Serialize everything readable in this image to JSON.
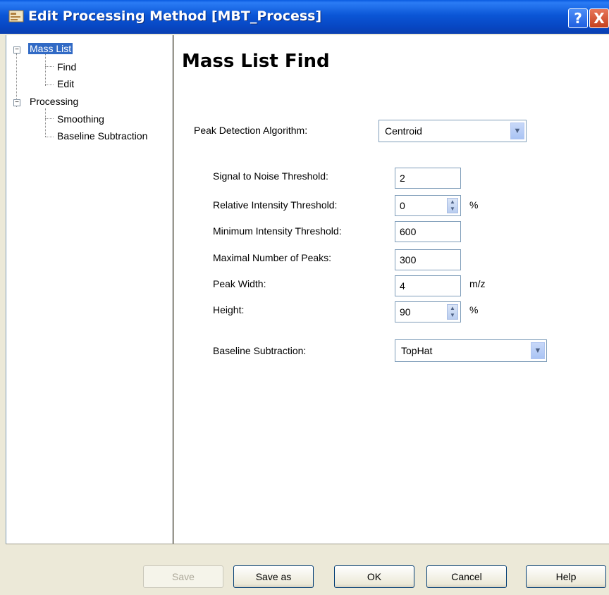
{
  "window": {
    "title": "Edit Processing Method [MBT_Process]",
    "help_glyph": "?",
    "close_glyph": "X"
  },
  "tree": {
    "expander_glyph": "−",
    "nodes": [
      {
        "label": "Mass List",
        "selected": true,
        "children": [
          "Find",
          "Edit"
        ]
      },
      {
        "label": "Processing",
        "selected": false,
        "children": [
          "Smoothing",
          "Baseline Subtraction"
        ]
      }
    ]
  },
  "content": {
    "heading": "Mass List Find",
    "peak_detection": {
      "label": "Peak Detection Algorithm:",
      "value": "Centroid"
    },
    "fields": [
      {
        "label": "Signal to Noise Threshold:",
        "value": "2",
        "unit": "",
        "spinner": false
      },
      {
        "label": "Relative Intensity Threshold:",
        "value": "0",
        "unit": "%",
        "spinner": true
      },
      {
        "label": "Minimum Intensity Threshold:",
        "value": "600",
        "unit": "",
        "spinner": false
      },
      {
        "label": "Maximal Number of Peaks:",
        "value": "300",
        "unit": "",
        "spinner": false
      },
      {
        "label": "Peak Width:",
        "value": "4",
        "unit": "m/z",
        "spinner": false
      },
      {
        "label": "Height:",
        "value": "90",
        "unit": "%",
        "spinner": true
      }
    ],
    "baseline": {
      "label": "Baseline Subtraction:",
      "value": "TopHat"
    }
  },
  "buttons": {
    "save": "Save",
    "save_as": "Save as",
    "ok": "OK",
    "cancel": "Cancel",
    "help": "Help"
  }
}
